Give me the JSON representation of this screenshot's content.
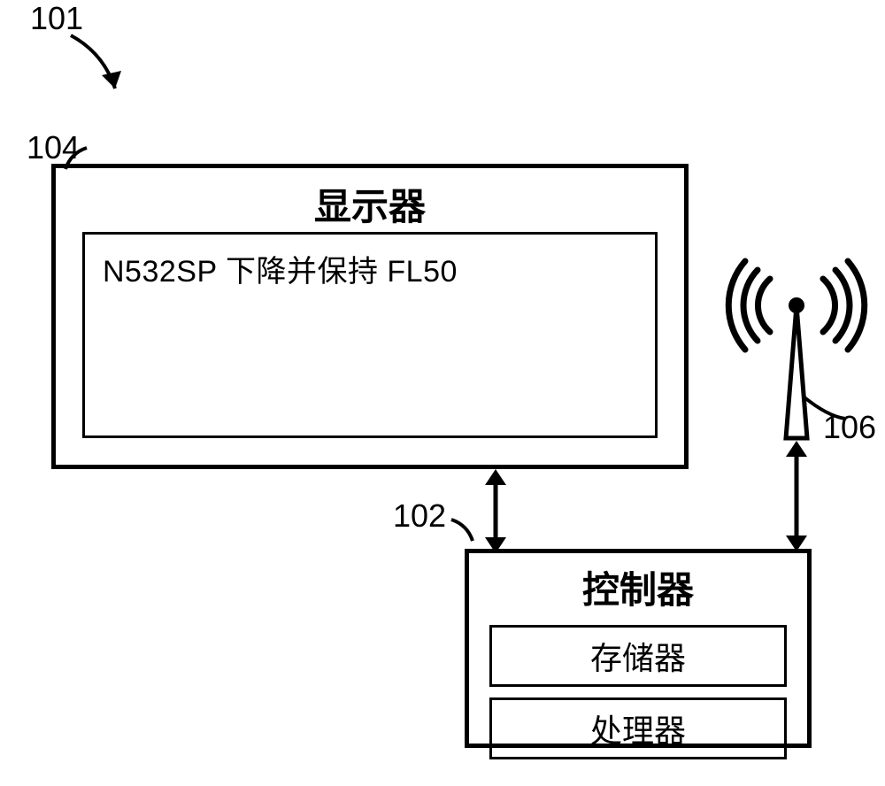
{
  "labels": {
    "ref101": "101",
    "ref104": "104",
    "ref102": "102",
    "ref106": "106"
  },
  "display": {
    "title": "显示器",
    "message": "N532SP 下降并保持 FL50"
  },
  "controller": {
    "title": "控制器",
    "memory": "存储器",
    "processor": "处理器"
  }
}
